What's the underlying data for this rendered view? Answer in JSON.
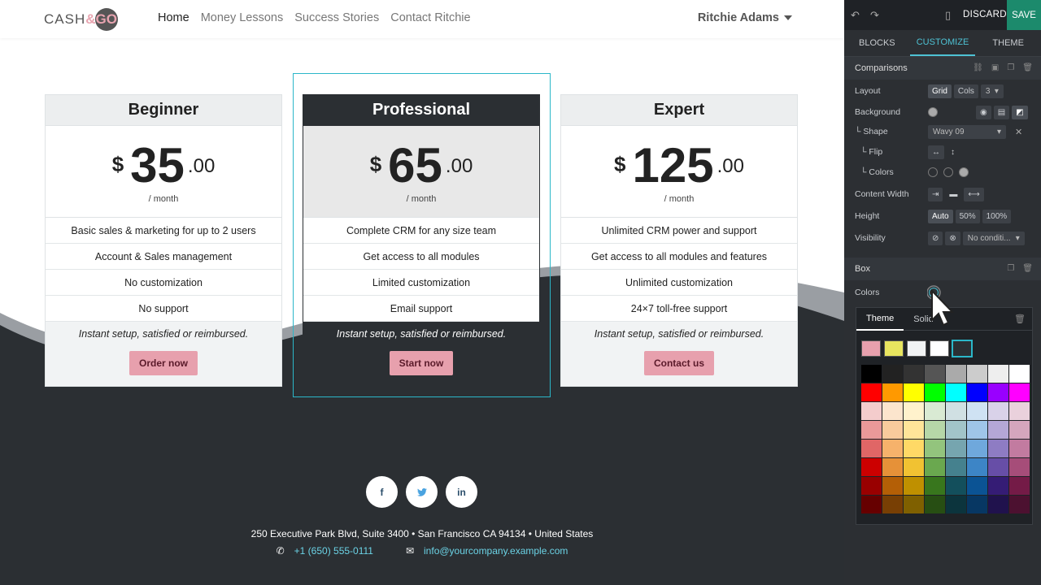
{
  "site": {
    "logo": {
      "prefix": "CASH",
      "amp": "&GO"
    },
    "nav": [
      "Home",
      "Money Lessons",
      "Success Stories",
      "Contact Ritchie"
    ],
    "user": "Ritchie Adams",
    "plans": [
      {
        "name": "Beginner",
        "currency": "$",
        "amount": "35",
        "cents": ".00",
        "period": "/ month",
        "features": [
          "Basic sales & marketing for up to 2 users",
          "Account & Sales management",
          "No customization",
          "No support"
        ],
        "note": "Instant setup, satisfied or reimbursed.",
        "cta": "Order now"
      },
      {
        "name": "Professional",
        "currency": "$",
        "amount": "65",
        "cents": ".00",
        "period": "/ month",
        "features": [
          "Complete CRM for any size team",
          "Get access to all modules",
          "Limited customization",
          "Email support"
        ],
        "note": "Instant setup, satisfied or reimbursed.",
        "cta": "Start now"
      },
      {
        "name": "Expert",
        "currency": "$",
        "amount": "125",
        "cents": ".00",
        "period": "/ month",
        "features": [
          "Unlimited CRM power and support",
          "Get access to all modules and features",
          "Unlimited customization",
          "24×7 toll-free support"
        ],
        "note": "Instant setup, satisfied or reimbursed.",
        "cta": "Contact us"
      }
    ],
    "social": [
      {
        "name": "facebook",
        "glyph": "f"
      },
      {
        "name": "twitter",
        "glyph": "t"
      },
      {
        "name": "linkedin",
        "glyph": "in"
      }
    ],
    "address": "250 Executive Park Blvd, Suite 3400 • San Francisco CA 94134 • United States",
    "phone": "+1 (650) 555-0111",
    "email": "info@yourcompany.example.com"
  },
  "editor": {
    "discard": "DISCARD",
    "save": "SAVE",
    "tabs": [
      "BLOCKS",
      "CUSTOMIZE",
      "THEME"
    ],
    "active_tab": "CUSTOMIZE",
    "section": "Comparisons",
    "rows": {
      "layout": {
        "label": "Layout",
        "options": [
          "Grid",
          "Cols"
        ],
        "cols_value": "3"
      },
      "background": {
        "label": "Background"
      },
      "shape": {
        "label": "└ Shape",
        "value": "Wavy 09"
      },
      "flip": {
        "label": "└ Flip"
      },
      "colors": {
        "label": "└ Colors"
      },
      "content_width": {
        "label": "Content Width"
      },
      "height": {
        "label": "Height",
        "options": [
          "Auto",
          "50%",
          "100%"
        ]
      },
      "visibility": {
        "label": "Visibility",
        "value": "No conditi..."
      }
    },
    "box_section": "Box",
    "box_colors": "Colors",
    "palette_tabs": [
      "Theme",
      "Solid"
    ]
  },
  "colors": {
    "accent": "#2bb7c9",
    "cta": "#e7a0ad",
    "dark": "#2b2f33",
    "save": "#1c8a6c"
  }
}
